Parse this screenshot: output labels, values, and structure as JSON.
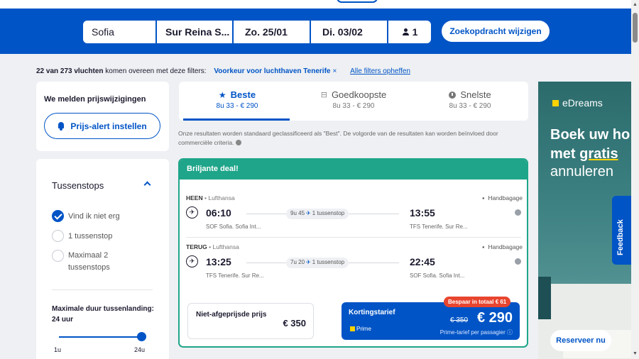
{
  "search": {
    "origin": "Sofia",
    "destination": "Sur Reina S...",
    "depart_date": "Zo. 25/01",
    "return_date": "Di. 03/02",
    "passengers": "1",
    "modify_button": "Zoekopdracht wijzigen"
  },
  "filters": {
    "count_text": "22 van 273 vluchten",
    "match_text": "komen overeen met deze filters:",
    "active_chip": "Voorkeur voor luchthaven Tenerife",
    "chip_remove": "×",
    "clear_all": "Alle filters opheffen"
  },
  "price_alert": {
    "title": "We melden prijswijzigingen",
    "button": "Prijs-alert instellen"
  },
  "stops": {
    "title": "Tussenstops",
    "options": [
      "Vind ik niet erg",
      "1 tussenstop",
      "Maximaal 2 tussenstops"
    ],
    "duration_label": "Maximale duur tussenlanding: 24 uur",
    "slider_min": "1u",
    "slider_max": "24u"
  },
  "sort_tabs": [
    {
      "label": "Beste",
      "sub": "8u 33 - € 290"
    },
    {
      "label": "Goedkoopste",
      "sub": "8u 33 - € 290"
    },
    {
      "label": "Snelste",
      "sub": "8u 33 - € 290"
    }
  ],
  "sort_note": "Onze resultaten worden standaard geclassificeerd als \"Best\". De volgorde van de resultaten kan worden beïnvloed door commerciële criteria.",
  "deal": {
    "header": "Briljante deal!",
    "outbound": {
      "direction": "HEEN",
      "airline": "Lufthansa",
      "baggage": "Handbagage",
      "dep_time": "06:10",
      "arr_time": "13:55",
      "duration": "9u 45",
      "stops": "1 tussenstop",
      "dep_airport": "SOF Sofia. Sofia Int...",
      "arr_airport": "TFS Tenerife. Sur Re..."
    },
    "inbound": {
      "direction": "TERUG",
      "airline": "Lufthansa",
      "baggage": "Handbagage",
      "dep_time": "13:25",
      "arr_time": "22:45",
      "duration": "7u 20",
      "stops": "1 tussenstop",
      "dep_airport": "TFS Tenerife. Sur Re...",
      "arr_airport": "SOF Sofia. Sofia Int..."
    },
    "standard_label": "Niet-afgeprijsde prijs",
    "standard_price": "€ 350",
    "prime_label": "Kortingstarief",
    "prime_logo": "Prime",
    "prime_old_price": "€ 350",
    "prime_price": "€ 290",
    "prime_sub": "Prime-tarief per passagier",
    "save_badge": "Bespaar in totaal € 61"
  },
  "ad": {
    "brand": "eDreams",
    "line1": "Boek uw ho",
    "line2_a": "met ",
    "line2_b": "gratis",
    "line3": "annuleren",
    "cta": "Reserveer nu"
  },
  "feedback": "Feedback",
  "colors": {
    "brand_blue": "#0054c6",
    "deal_green": "#1fa589",
    "save_red": "#e8452f",
    "prime_yellow": "#ffd200"
  }
}
